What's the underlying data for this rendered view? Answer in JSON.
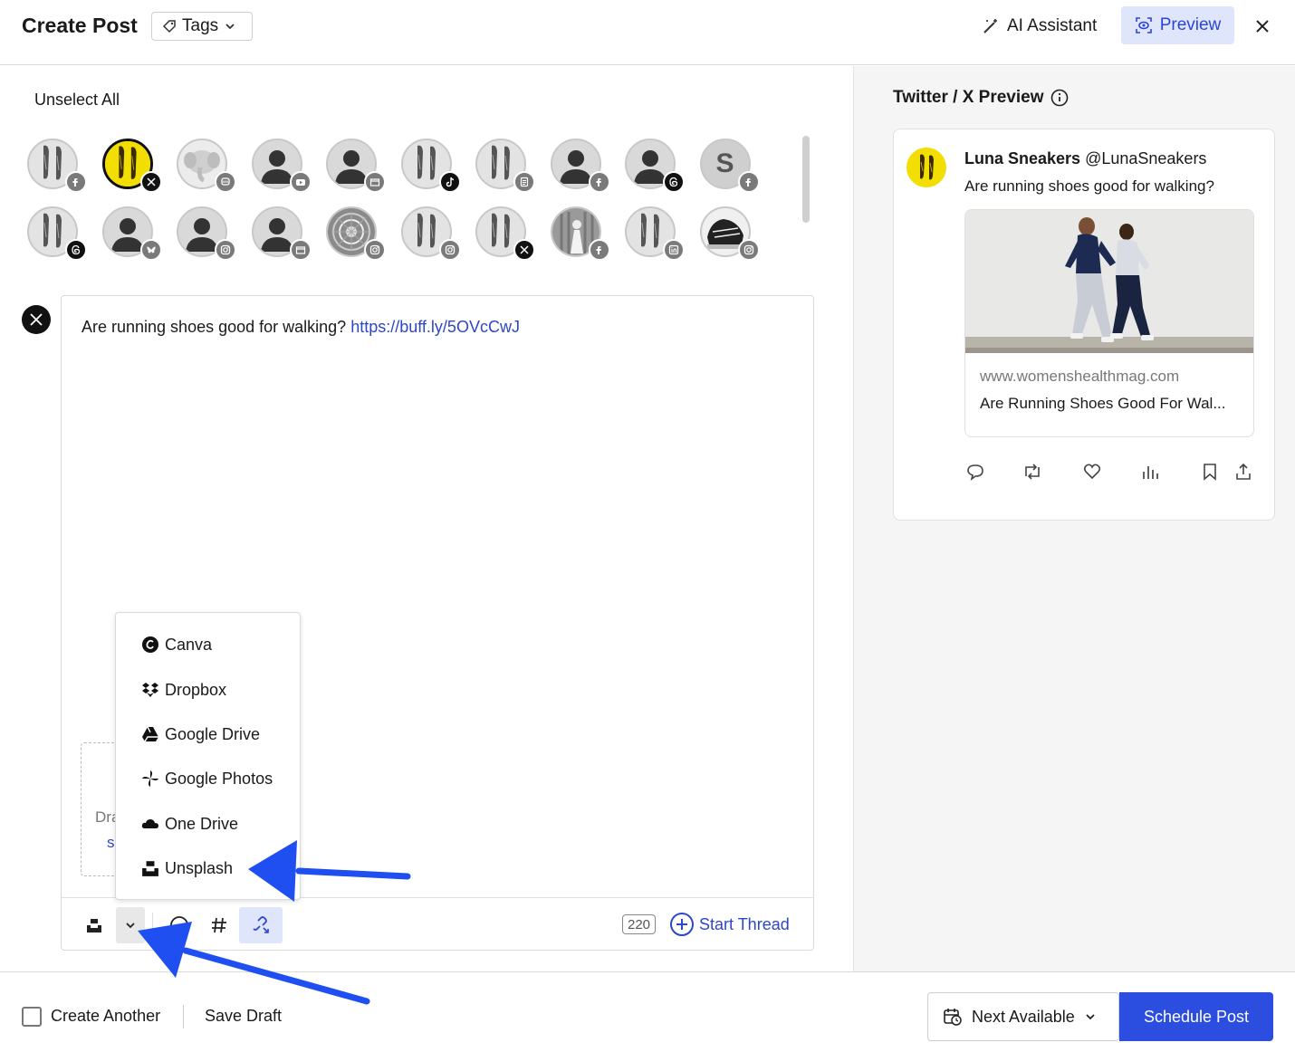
{
  "header": {
    "title": "Create Post",
    "tags_label": "Tags",
    "ai_label": "AI Assistant",
    "preview_label": "Preview"
  },
  "composer": {
    "unselect_all": "Unselect All",
    "post_text": "Are running shoes good for walking?",
    "post_link": "https://buff.ly/5OVcCwJ",
    "dropzone_text": "Dra",
    "dropzone_link": "s",
    "char_count": "220",
    "start_thread": "Start Thread"
  },
  "upload_menu": {
    "items": [
      {
        "label": "Canva",
        "icon": "canva-icon"
      },
      {
        "label": "Dropbox",
        "icon": "dropbox-icon"
      },
      {
        "label": "Google Drive",
        "icon": "google-drive-icon"
      },
      {
        "label": "Google Photos",
        "icon": "google-photos-icon"
      },
      {
        "label": "One Drive",
        "icon": "one-drive-icon"
      },
      {
        "label": "Unsplash",
        "icon": "unsplash-icon"
      }
    ]
  },
  "channels": [
    {
      "network": "facebook",
      "selected": false
    },
    {
      "network": "x",
      "selected": true
    },
    {
      "network": "mastodon",
      "selected": false
    },
    {
      "network": "youtube",
      "selected": false
    },
    {
      "network": "google-business",
      "selected": false
    },
    {
      "network": "tiktok",
      "selected": false
    },
    {
      "network": "start-page",
      "selected": false
    },
    {
      "network": "facebook",
      "selected": false
    },
    {
      "network": "threads",
      "selected": false
    },
    {
      "network": "facebook",
      "selected": false,
      "initial": "S"
    },
    {
      "network": "threads",
      "selected": false
    },
    {
      "network": "bluesky",
      "selected": false
    },
    {
      "network": "instagram",
      "selected": false
    },
    {
      "network": "google-business",
      "selected": false
    },
    {
      "network": "instagram",
      "selected": false
    },
    {
      "network": "instagram",
      "selected": false
    },
    {
      "network": "x",
      "selected": false
    },
    {
      "network": "facebook",
      "selected": false
    },
    {
      "network": "linkedin",
      "selected": false
    },
    {
      "network": "instagram",
      "selected": false
    }
  ],
  "preview": {
    "title": "Twitter / X Preview",
    "display_name": "Luna Sneakers",
    "handle": "@LunaSneakers",
    "text": "Are running shoes good for walking?",
    "link_domain": "www.womenshealthmag.com",
    "link_title": "Are Running Shoes Good For Wal..."
  },
  "footer": {
    "create_another": "Create Another",
    "save_draft": "Save Draft",
    "next_available": "Next Available",
    "schedule_post": "Schedule Post"
  },
  "colors": {
    "accent": "#2b4de0",
    "link": "#2c47c7",
    "preview_bg": "#dfe5fb",
    "annotation_arrow": "#1f4ff0"
  }
}
